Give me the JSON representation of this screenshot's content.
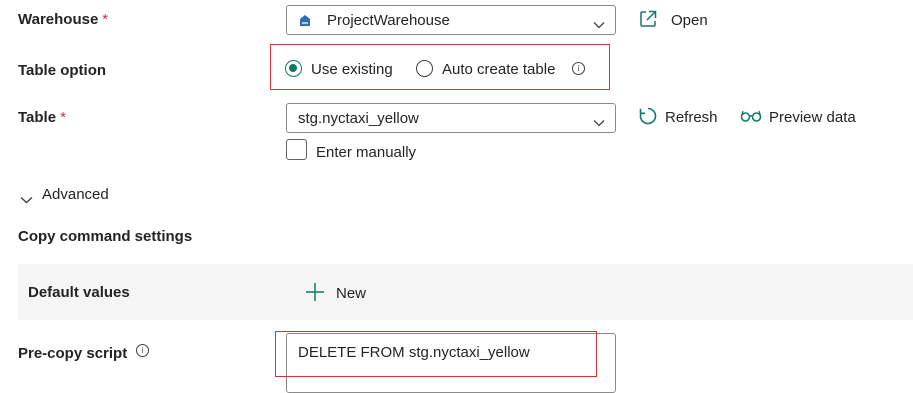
{
  "warehouse": {
    "label": "Warehouse",
    "required_mark": "*",
    "selected": "ProjectWarehouse",
    "open_label": "Open"
  },
  "table_option": {
    "label": "Table option",
    "options": [
      {
        "label": "Use existing",
        "selected": true
      },
      {
        "label": "Auto create table",
        "selected": false
      }
    ]
  },
  "table": {
    "label": "Table",
    "required_mark": "*",
    "selected": "stg.nyctaxi_yellow",
    "refresh_label": "Refresh",
    "preview_label": "Preview data",
    "enter_manually_label": "Enter manually",
    "enter_manually_checked": false
  },
  "advanced": {
    "label": "Advanced"
  },
  "copy_command": {
    "title": "Copy command settings",
    "default_values_label": "Default values",
    "new_label": "New"
  },
  "pre_copy": {
    "label": "Pre-copy script",
    "value": "DELETE FROM stg.nyctaxi_yellow"
  },
  "colors": {
    "accent": "#117865",
    "highlight_border": "#d13438",
    "required": "#c4314b"
  }
}
